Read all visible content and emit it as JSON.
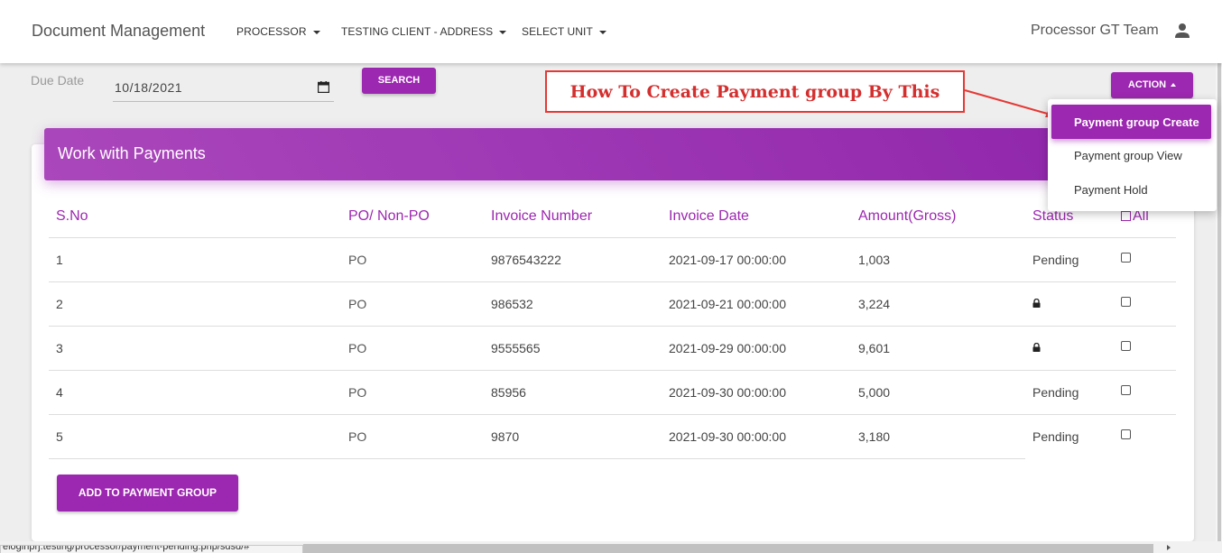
{
  "navbar": {
    "brand": "Document Management",
    "menus": [
      "PROCESSOR",
      "TESTING CLIENT - ADDRESS",
      "SELECT UNIT"
    ],
    "user_name": "Processor GT Team"
  },
  "filter": {
    "due_date_label": "Due Date",
    "due_date_value": "10/18/2021",
    "search_label": "SEARCH"
  },
  "action": {
    "label": "ACTION",
    "items": [
      "Payment group Create",
      "Payment group View",
      "Payment Hold"
    ]
  },
  "annotation": {
    "text": "How To Create Payment group By This",
    "color": "#d32f2f"
  },
  "card": {
    "title": "Work with Payments"
  },
  "table": {
    "headers": [
      "S.No",
      "PO/ Non-PO",
      "Invoice Number",
      "Invoice Date",
      "Amount(Gross)",
      "Status",
      "All"
    ],
    "rows": [
      {
        "sno": "1",
        "po": "PO",
        "invoice": "9876543222",
        "date": "2021-09-17 00:00:00",
        "amount": "1,003",
        "status": "Pending",
        "locked": false
      },
      {
        "sno": "2",
        "po": "PO",
        "invoice": "986532",
        "date": "2021-09-21 00:00:00",
        "amount": "3,224",
        "status": "",
        "locked": true
      },
      {
        "sno": "3",
        "po": "PO",
        "invoice": "9555565",
        "date": "2021-09-29 00:00:00",
        "amount": "9,601",
        "status": "",
        "locked": true
      },
      {
        "sno": "4",
        "po": "PO",
        "invoice": "85956",
        "date": "2021-09-30 00:00:00",
        "amount": "5,000",
        "status": "Pending",
        "locked": false
      },
      {
        "sno": "5",
        "po": "PO",
        "invoice": "9870",
        "date": "2021-09-30 00:00:00",
        "amount": "3,180",
        "status": "Pending",
        "locked": false
      }
    ]
  },
  "add_button_label": "ADD TO PAYMENT GROUP",
  "statusbar_url": "eloginprj.testing/processor/payment-pending.php/sdsd/#",
  "colors": {
    "accent": "#9c27b0",
    "annotation": "#e53935"
  }
}
